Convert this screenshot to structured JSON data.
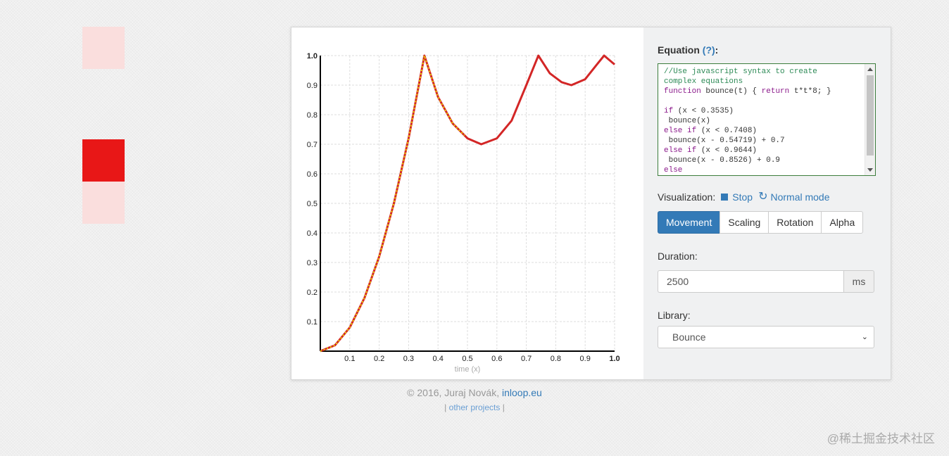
{
  "equation": {
    "label": "Equation",
    "help": "(?)",
    "colon": ":",
    "code_lines": [
      [
        {
          "t": "//Use javascript syntax to create",
          "c": "c"
        }
      ],
      [
        {
          "t": "complex equations",
          "c": "c"
        }
      ],
      [
        {
          "t": "function",
          "c": "k"
        },
        {
          "t": " bounce(t) { "
        },
        {
          "t": "return",
          "c": "k"
        },
        {
          "t": " t*t*8; }"
        }
      ],
      [],
      [
        {
          "t": "if",
          "c": "k"
        },
        {
          "t": " (x < 0.3535)"
        }
      ],
      [
        {
          "t": " bounce(x)"
        }
      ],
      [
        {
          "t": "else if",
          "c": "k"
        },
        {
          "t": " (x < 0.7408)"
        }
      ],
      [
        {
          "t": " bounce(x - 0.54719) + 0.7"
        }
      ],
      [
        {
          "t": "else if",
          "c": "k"
        },
        {
          "t": " (x < 0.9644)"
        }
      ],
      [
        {
          "t": " bounce(x - 0.8526) + 0.9"
        }
      ],
      [
        {
          "t": "else",
          "c": "k"
        }
      ]
    ]
  },
  "visualization": {
    "label": "Visualization:",
    "stop": "Stop",
    "normal_mode": "Normal mode"
  },
  "modes": [
    "Movement",
    "Scaling",
    "Rotation",
    "Alpha"
  ],
  "active_mode": 0,
  "duration": {
    "label": "Duration:",
    "value": "2500",
    "unit": "ms"
  },
  "library": {
    "label": "Library:",
    "selected": "Bounce"
  },
  "footer": {
    "copyright": "© 2016, Juraj Novák,",
    "link": "inloop.eu",
    "other": "other projects",
    "sep_left": "|",
    "sep_right": "|"
  },
  "watermark": "@稀土掘金技术社区",
  "colors": {
    "accent": "#337ab7",
    "curve": "#d32626",
    "trace": "#e8d600",
    "box_active": "#e81717",
    "box_faded": "#fadedd"
  },
  "chart_data": {
    "type": "line",
    "xlabel": "time (x)",
    "ylabel": "",
    "xlim": [
      0,
      1
    ],
    "ylim": [
      0,
      1
    ],
    "x_ticks": [
      "0.1",
      "0.2",
      "0.3",
      "0.4",
      "0.5",
      "0.6",
      "0.7",
      "0.8",
      "0.9",
      "1.0"
    ],
    "y_ticks": [
      "0.1",
      "0.2",
      "0.3",
      "0.4",
      "0.5",
      "0.6",
      "0.7",
      "0.8",
      "0.9",
      "1.0"
    ],
    "grid": true,
    "series": [
      {
        "style": "solid",
        "color": "#d32626",
        "x": [
          0,
          0.05,
          0.1,
          0.15,
          0.2,
          0.25,
          0.3,
          0.35,
          0.3535,
          0.4,
          0.45,
          0.5,
          0.547,
          0.6,
          0.65,
          0.7,
          0.7408,
          0.78,
          0.82,
          0.853,
          0.9,
          0.94,
          0.9644,
          1.0
        ],
        "y": [
          0,
          0.02,
          0.08,
          0.18,
          0.32,
          0.5,
          0.72,
          0.98,
          1.0,
          0.86,
          0.77,
          0.72,
          0.7,
          0.72,
          0.78,
          0.9,
          1.0,
          0.94,
          0.91,
          0.9,
          0.92,
          0.97,
          1.0,
          0.97
        ]
      },
      {
        "style": "dotted",
        "color": "#e8d600",
        "x": [
          0,
          0.05,
          0.1,
          0.15,
          0.2,
          0.25,
          0.3,
          0.35,
          0.3535,
          0.4,
          0.45,
          0.49
        ],
        "y": [
          0,
          0.02,
          0.08,
          0.18,
          0.32,
          0.5,
          0.72,
          0.98,
          1.0,
          0.86,
          0.77,
          0.73
        ]
      }
    ]
  }
}
